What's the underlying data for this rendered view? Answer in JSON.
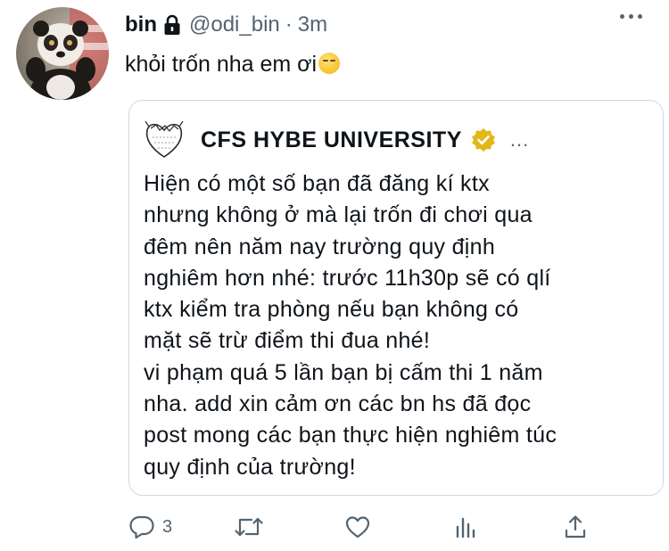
{
  "tweet": {
    "display_name": "bin",
    "handle": "@odi_bin",
    "separator": "·",
    "time": "3m",
    "text": "khỏi trốn nha em ơi",
    "emoji": "smirking-face"
  },
  "quoted_tweet": {
    "display_name": "CFS HYBE UNIVERSITY",
    "verified": true,
    "more_label": "...",
    "lines": [
      "Hiện có một số bạn đã đăng kí ktx",
      "nhưng không ở mà lại trốn đi chơi qua",
      "đêm nên năm nay trường quy định",
      "nghiêm hơn nhé: trước 11h30p sẽ có qlí",
      "ktx kiểm tra phòng nếu bạn không có",
      "mặt sẽ trừ điểm thi đua nhé!",
      "vi phạm quá 5 lần bạn bị cấm thi 1 năm",
      "nha. add xin cảm ơn các bn hs đã đọc",
      "post mong các bạn thực hiện nghiêm túc",
      "quy định của trường!"
    ]
  },
  "actions": {
    "reply_count": "3",
    "icons": [
      "reply-icon",
      "retweet-icon",
      "like-icon",
      "analytics-icon",
      "share-icon"
    ]
  },
  "colors": {
    "text": "#0f1419",
    "secondary": "#536471",
    "border": "#cfd9de",
    "verified_gold": "#e2b719"
  }
}
